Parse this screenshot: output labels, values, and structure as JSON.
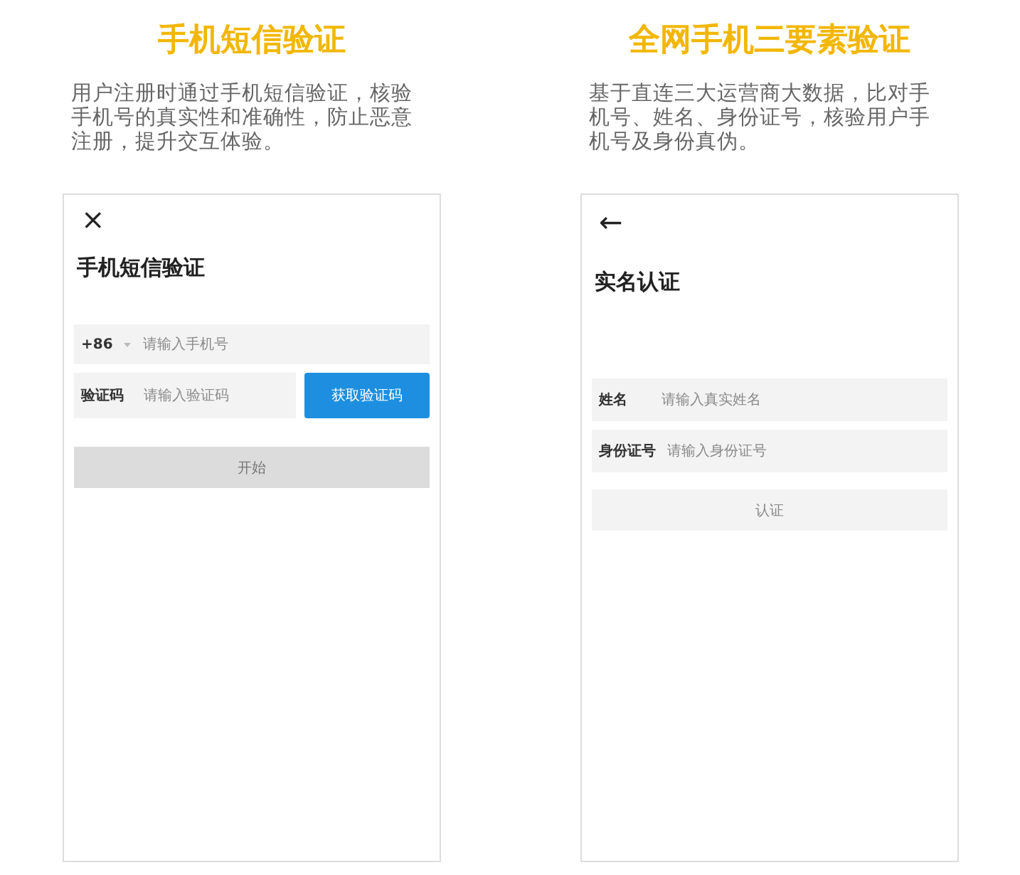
{
  "panels": [
    {
      "title": "手机短信验证",
      "description": "用户注册时通过手机短信验证，核验手机号的真实性和准确性，防止恶意注册，提升交互体验。",
      "screen": {
        "nav_icon": "×",
        "heading": "手机短信验证",
        "fields": [
          {
            "kind": "phone",
            "prefix": "+86",
            "placeholder": "请输入手机号"
          },
          {
            "kind": "code",
            "label": "验证码",
            "placeholder": "请输入验证码",
            "button": "获取验证码"
          }
        ],
        "action": {
          "label": "开始",
          "disabled": true
        }
      }
    },
    {
      "title": "全网手机三要素验证",
      "description": "基于直连三大运营商大数据，比对手机号、姓名、身份证号，核验用户手机号及身份真伪。",
      "screen": {
        "nav_icon": "←",
        "heading": "实名认证",
        "fields": [
          {
            "kind": "plain",
            "label": "姓名",
            "placeholder": "请输入真实姓名"
          },
          {
            "kind": "plain",
            "label": "身份证号",
            "placeholder": "请输入身份证号"
          }
        ],
        "action": {
          "label": "认证",
          "disabled": true
        }
      }
    }
  ]
}
